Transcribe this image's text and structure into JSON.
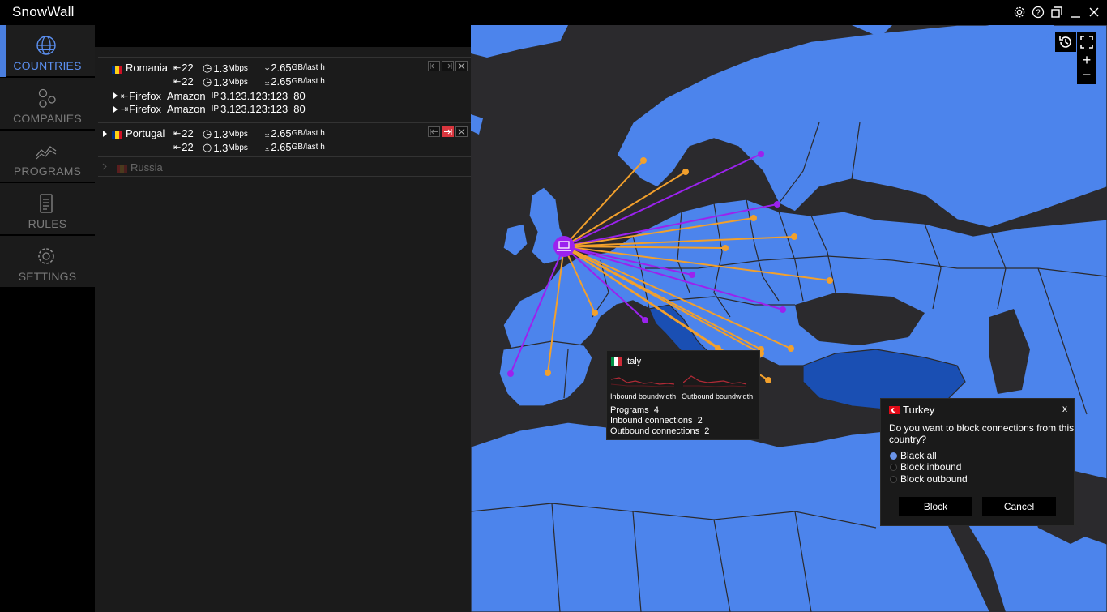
{
  "app": {
    "title": "SnowWall"
  },
  "window_controls": [
    "gear-icon",
    "help-icon",
    "restore-icon",
    "minimize-icon",
    "close-icon"
  ],
  "nav": {
    "items": [
      {
        "label": "COUNTRIES",
        "icon": "globe-icon",
        "active": true
      },
      {
        "label": "COMPANIES",
        "icon": "companies-icon"
      },
      {
        "label": "PROGRAMS",
        "icon": "chart-line-icon"
      },
      {
        "label": "RULES",
        "icon": "list-icon"
      },
      {
        "label": "SETTINGS",
        "icon": "gear-icon"
      }
    ]
  },
  "countries": [
    {
      "name": "Romania",
      "flag": [
        "#002b7f",
        "#fcd116",
        "#ce1126"
      ],
      "inbound_count": "22",
      "inbound_count_2": "22",
      "speed": "1.3",
      "speed_unit": "Mbps",
      "speed_2": "1.3",
      "speed_unit_2": "Mbps",
      "traffic": "2.65",
      "traffic_unit": "GB/last h",
      "traffic_2": "2.65",
      "traffic_unit_2": "GB/last h",
      "connections": [
        {
          "program": "Firefox",
          "company": "Amazon",
          "ip_label": "IP",
          "ip": "3.123.123:123",
          "port": "80"
        },
        {
          "program": "Firefox",
          "company": "Amazon",
          "ip_label": "IP",
          "ip": "3.123.123:123",
          "port": "80"
        }
      ]
    },
    {
      "name": "Portugal",
      "flag": [
        "#002b7f",
        "#fcd116",
        "#ce1126"
      ],
      "inbound_count": "22",
      "inbound_count_2": "22",
      "speed": "1.3",
      "speed_unit": "Mbps",
      "speed_2": "1.3",
      "speed_unit_2": "Mbps",
      "traffic": "2.65",
      "traffic_unit": "GB/last h",
      "traffic_2": "2.65",
      "traffic_unit_2": "GB/last h"
    },
    {
      "name": "Russia",
      "flag": [
        "#5a1e1e",
        "#4a3a1e",
        "#4a1e1e"
      ]
    }
  ],
  "map": {
    "zoom_in": "+",
    "zoom_out": "−",
    "colors": {
      "land": "#4c84ec",
      "sea": "#2b2a2d",
      "highlight": "#1a4fb3",
      "inbound": "#f2a02c",
      "outbound": "#9b22ee"
    }
  },
  "tooltip": {
    "country": "Italy",
    "flag": [
      "#009246",
      "#ffffff",
      "#ce2b37"
    ],
    "inbound_label": "Inbound boundwidth",
    "outbound_label": "Outbound boundwidth",
    "programs_label": "Programs",
    "programs_value": "4",
    "inbound_conn_label": "Inbound connections",
    "inbound_conn_value": "2",
    "outbound_conn_label": "Outbound connections",
    "outbound_conn_value": "2"
  },
  "dialog": {
    "country": "Turkey",
    "close": "x",
    "question": "Do you want to block connections from this",
    "question_2": "country?",
    "options": [
      "Black all",
      "Block inbound",
      "Block outbound"
    ],
    "selected": "Black all",
    "block_label": "Block",
    "cancel_label": "Cancel"
  }
}
